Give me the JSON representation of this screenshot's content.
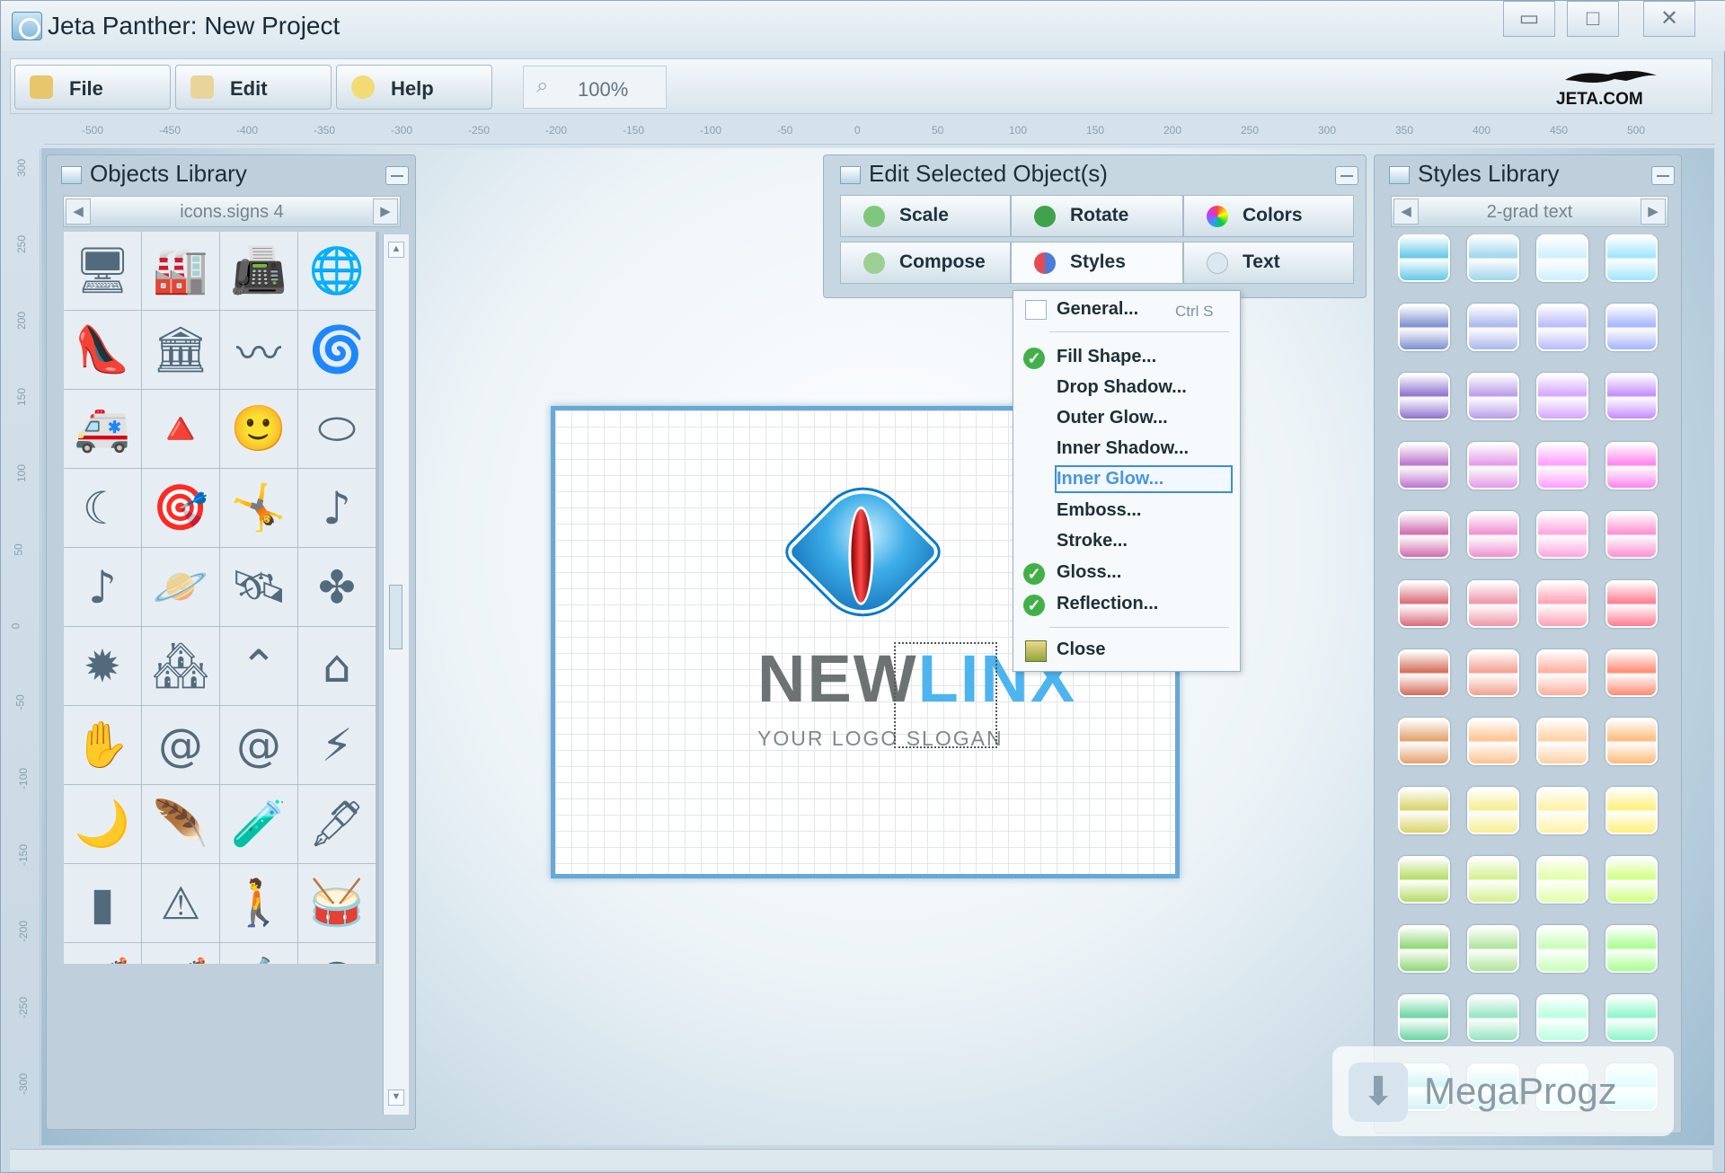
{
  "window": {
    "title": "Jeta Panther: New Project",
    "controls": [
      "▭",
      "□",
      "✕"
    ]
  },
  "toolbar": {
    "file": "File",
    "edit": "Edit",
    "help": "Help",
    "zoom": "100%",
    "brand": "JETA.COM"
  },
  "rulers": {
    "horizontal": [
      "-500",
      "-450",
      "-400",
      "-350",
      "-300",
      "-250",
      "-200",
      "-150",
      "-100",
      "-50",
      "0",
      "50",
      "100",
      "150",
      "200",
      "250",
      "300",
      "350",
      "400",
      "450",
      "500"
    ],
    "vertical": [
      "300",
      "250",
      "200",
      "150",
      "100",
      "50",
      "0",
      "-50",
      "-100",
      "-150",
      "-200",
      "-250",
      "-300"
    ]
  },
  "objects_panel": {
    "title": "Objects Library",
    "category": "icons.signs 4",
    "icons": [
      "🖥",
      "🏭",
      "📠",
      "🌐",
      "👠",
      "🏛",
      "〰",
      "🌀",
      "🚑",
      "🔺",
      "🙂",
      "⬭",
      "☾",
      "🎯",
      "🤸",
      "♪",
      "♪",
      "🪐",
      "🛰",
      "✤",
      "✹",
      "🏘",
      "⌃",
      "⌂",
      "✋",
      "@",
      "@",
      "⚡",
      "🌙",
      "🪶",
      "🧪",
      "🖋",
      "▮",
      "⚠",
      "🚶",
      "🥁",
      "🎻",
      "🎻",
      "🔬",
      "☺",
      "🦁",
      "☁",
      "☁",
      "⟋",
      "🐾",
      "🏯",
      "🛸",
      "⋮"
    ]
  },
  "edit_panel": {
    "title": "Edit Selected Object(s)",
    "scale": "Scale",
    "rotate": "Rotate",
    "colors": "Colors",
    "compose": "Compose",
    "styles": "Styles",
    "text": "Text"
  },
  "styles_menu": {
    "general": "General...",
    "shortcut": "Ctrl S",
    "fill_shape": "Fill Shape...",
    "drop_shadow": "Drop Shadow...",
    "outer_glow": "Outer Glow...",
    "inner_shadow": "Inner Shadow...",
    "inner_glow": "Inner Glow...",
    "emboss": "Emboss...",
    "stroke": "Stroke...",
    "gloss": "Gloss...",
    "reflection": "Reflection...",
    "close": "Close"
  },
  "artboard": {
    "logo_word_1": "NEW",
    "logo_word_2": "LINX",
    "slogan": "YOUR LOGO SLOGAN"
  },
  "styles_panel": {
    "title": "Styles Library",
    "category": "2-grad text",
    "swatch_colors": [
      "#63c8e8",
      "#9fd5ec",
      "#cdefff",
      "#9ee5ff",
      "#7d8fd0",
      "#aab6ec",
      "#b8b9ff",
      "#a4b4ff",
      "#8d73cf",
      "#b99ce8",
      "#d3a4ff",
      "#c28cff",
      "#ba75cc",
      "#e49ae8",
      "#ff9cff",
      "#ff83ed",
      "#d06cae",
      "#f090d1",
      "#ffa4df",
      "#ff8fd0",
      "#d96b7a",
      "#ef95a9",
      "#ffa0b4",
      "#ff7b91",
      "#d46c5a",
      "#f3a08f",
      "#ffad9c",
      "#ff8a73",
      "#e3a16b",
      "#ffc28f",
      "#ffd0a3",
      "#ffba79",
      "#d9d36a",
      "#f6ee8e",
      "#fff1a2",
      "#fff07a",
      "#b4dd67",
      "#d4f08f",
      "#e2ffa5",
      "#d0ff80",
      "#8fd774",
      "#aee59b",
      "#c6ffb5",
      "#a8ff90",
      "#6bd4a3",
      "#95e4c0",
      "#b8ffe1",
      "#8bf6c9",
      "#62d6d7",
      "#93e6e7",
      "#c3ffff",
      "#88f4ff"
    ]
  },
  "watermark": {
    "text": "MegaProgz"
  }
}
